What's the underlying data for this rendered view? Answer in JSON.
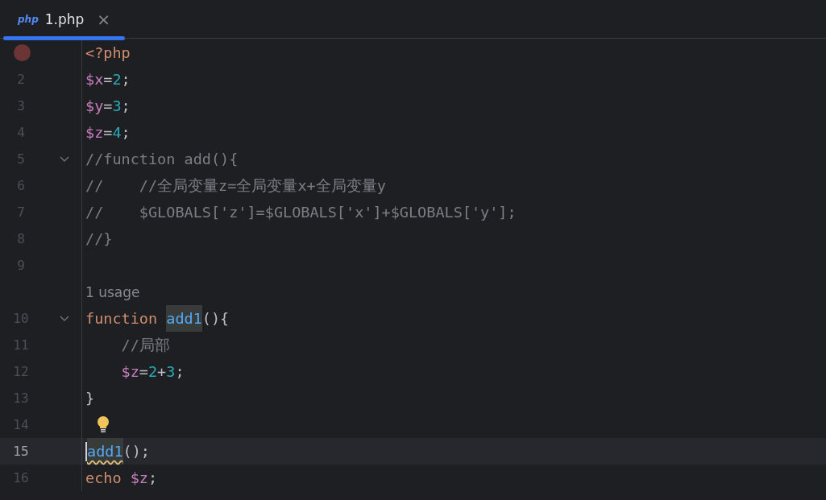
{
  "tabs": [
    {
      "icon_text": "php",
      "label": "1.php",
      "close": "×",
      "selected": true
    }
  ],
  "lines": [
    {
      "kind": "code",
      "breakpoint": true,
      "tokens": [
        {
          "kind": "keyword",
          "s": "<?php"
        }
      ]
    },
    {
      "kind": "code",
      "number": "2",
      "tokens": [
        {
          "kind": "var",
          "s": "$x"
        },
        {
          "kind": "plain",
          "s": "="
        },
        {
          "kind": "num",
          "s": "2"
        },
        {
          "kind": "plain",
          "s": ";"
        }
      ]
    },
    {
      "kind": "code",
      "number": "3",
      "tokens": [
        {
          "kind": "var",
          "s": "$y"
        },
        {
          "kind": "plain",
          "s": "="
        },
        {
          "kind": "num",
          "s": "3"
        },
        {
          "kind": "plain",
          "s": ";"
        }
      ]
    },
    {
      "kind": "code",
      "number": "4",
      "tokens": [
        {
          "kind": "var",
          "s": "$z"
        },
        {
          "kind": "plain",
          "s": "="
        },
        {
          "kind": "num",
          "s": "4"
        },
        {
          "kind": "plain",
          "s": ";"
        }
      ]
    },
    {
      "kind": "code",
      "number": "5",
      "foldable": true,
      "tokens": [
        {
          "kind": "comment",
          "s": "//function add(){"
        }
      ]
    },
    {
      "kind": "code",
      "number": "6",
      "tokens": [
        {
          "kind": "comment",
          "s": "//    //全局变量z=全局变量x+全局变量y"
        }
      ]
    },
    {
      "kind": "code",
      "number": "7",
      "tokens": [
        {
          "kind": "comment",
          "s": "//    $GLOBALS['z']=$GLOBALS['x']+$GLOBALS['y'];"
        }
      ]
    },
    {
      "kind": "code",
      "number": "8",
      "tokens": [
        {
          "kind": "comment",
          "s": "//}"
        }
      ]
    },
    {
      "kind": "code",
      "number": "9"
    },
    {
      "kind": "hint",
      "text": "1 usage"
    },
    {
      "kind": "code",
      "number": "10",
      "foldable": true,
      "tokens": [
        {
          "kind": "keyword",
          "s": "function "
        },
        {
          "kind": "func",
          "s": "add1",
          "highlighted": true
        },
        {
          "kind": "plain",
          "s": "(){"
        }
      ]
    },
    {
      "kind": "code",
      "number": "11",
      "tokens": [
        {
          "kind": "comment",
          "s": "    //局部"
        }
      ]
    },
    {
      "kind": "code",
      "number": "12",
      "tokens": [
        {
          "kind": "var",
          "s": "    $z"
        },
        {
          "kind": "plain",
          "s": "="
        },
        {
          "kind": "num",
          "s": "2"
        },
        {
          "kind": "plain",
          "s": "+"
        },
        {
          "kind": "num",
          "s": "3"
        },
        {
          "kind": "plain",
          "s": ";"
        }
      ]
    },
    {
      "kind": "code",
      "number": "13",
      "tokens": [
        {
          "kind": "plain",
          "s": "}"
        }
      ]
    },
    {
      "kind": "code",
      "number": "14",
      "bulb": true
    },
    {
      "kind": "code",
      "number": "15",
      "current": true,
      "tokens": [
        {
          "kind": "func",
          "s": "add1",
          "highlighted": true,
          "warning": true
        },
        {
          "kind": "plain",
          "s": "();"
        }
      ]
    },
    {
      "kind": "code",
      "number": "16",
      "tokens": [
        {
          "kind": "keyword",
          "s": "echo "
        },
        {
          "kind": "var",
          "s": "$z"
        },
        {
          "kind": "plain",
          "s": ";"
        }
      ]
    }
  ]
}
